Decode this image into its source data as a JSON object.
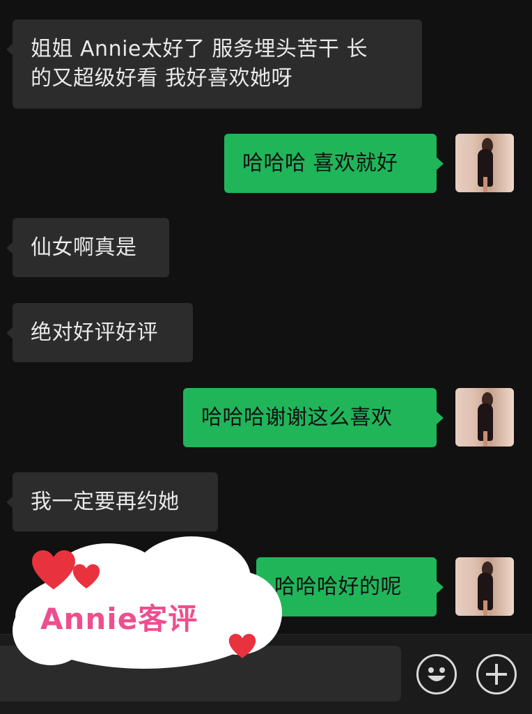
{
  "messages": [
    {
      "side": "in",
      "lines": [
        "姐姐 Annie太好了 服务埋头苦干 长",
        "的又超级好看 我好喜欢她呀"
      ]
    },
    {
      "side": "out",
      "text": "哈哈哈 喜欢就好"
    },
    {
      "side": "in",
      "text": "仙女啊真是"
    },
    {
      "side": "in",
      "text": "绝对好评好评"
    },
    {
      "side": "out",
      "text": "哈哈哈谢谢这么喜欢"
    },
    {
      "side": "in",
      "text": "我一定要再约她"
    },
    {
      "side": "out",
      "text": "哈哈哈好的呢"
    }
  ],
  "stamp": {
    "text": "Annie客评"
  },
  "input_bar": {
    "emoji_icon": "smiley-face-icon",
    "more_icon": "plus-circle-icon"
  },
  "colors": {
    "background": "#111111",
    "incoming_bubble": "#2c2c2c",
    "outgoing_bubble": "#21b55a",
    "stamp_text": "#ee4e8e",
    "heart": "#e8333f"
  }
}
